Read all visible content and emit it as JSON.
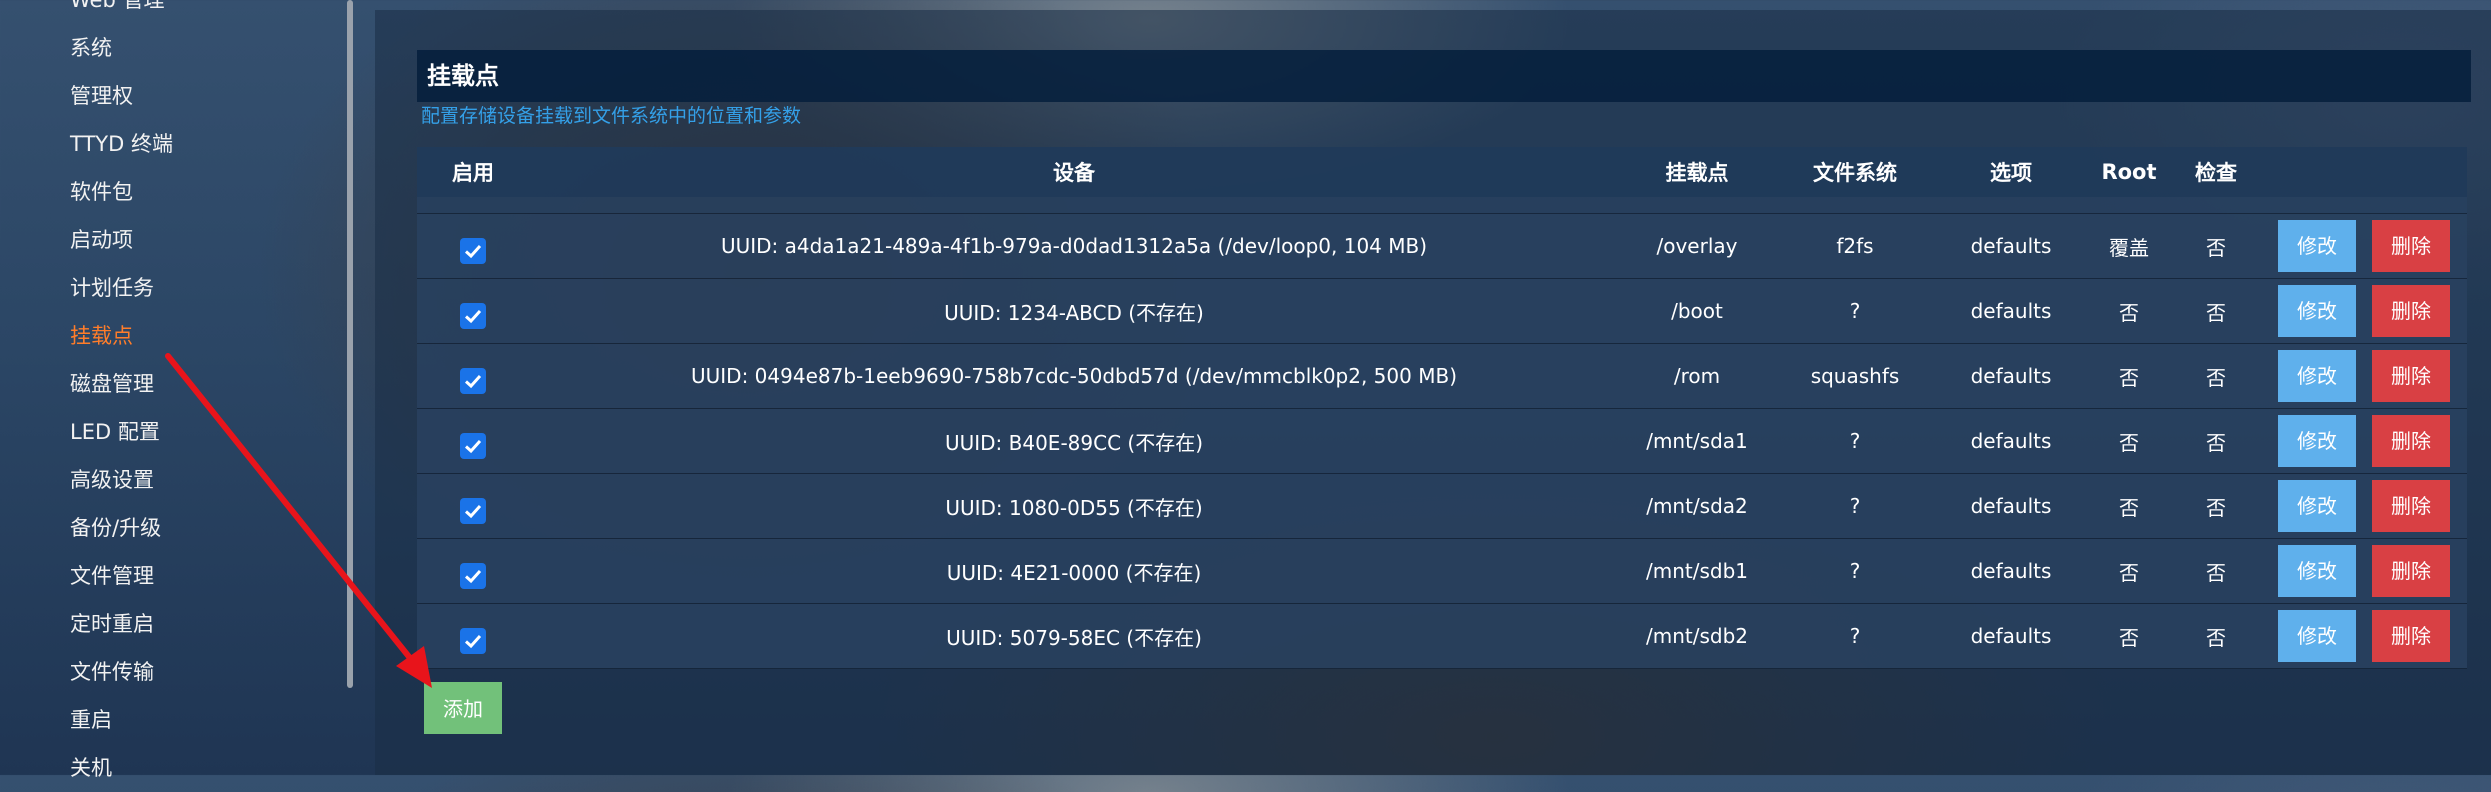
{
  "sidebar": {
    "items": [
      {
        "label": "Web 管理"
      },
      {
        "label": "系统"
      },
      {
        "label": "管理权"
      },
      {
        "label": "TTYD 终端"
      },
      {
        "label": "软件包"
      },
      {
        "label": "启动项"
      },
      {
        "label": "计划任务"
      },
      {
        "label": "挂载点"
      },
      {
        "label": "磁盘管理"
      },
      {
        "label": "LED 配置"
      },
      {
        "label": "高级设置"
      },
      {
        "label": "备份/升级"
      },
      {
        "label": "文件管理"
      },
      {
        "label": "定时重启"
      },
      {
        "label": "文件传输"
      },
      {
        "label": "重启"
      },
      {
        "label": "关机"
      }
    ],
    "active_label": "挂载点"
  },
  "section": {
    "title": "挂载点",
    "description": "配置存储设备挂载到文件系统中的位置和参数"
  },
  "table": {
    "headers": {
      "enabled": "启用",
      "device": "设备",
      "mountpoint": "挂载点",
      "filesystem": "文件系统",
      "options": "选项",
      "root": "Root",
      "check": "检查"
    },
    "rows": [
      {
        "enabled": true,
        "device": "UUID: a4da1a21-489a-4f1b-979a-d0dad1312a5a (/dev/loop0, 104 MB)",
        "mountpoint": "/overlay",
        "filesystem": "f2fs",
        "options": "defaults",
        "root": "覆盖",
        "check": "否",
        "edit": "修改",
        "delete": "删除"
      },
      {
        "enabled": true,
        "device": "UUID: 1234-ABCD (不存在)",
        "mountpoint": "/boot",
        "filesystem": "?",
        "options": "defaults",
        "root": "否",
        "check": "否",
        "edit": "修改",
        "delete": "删除"
      },
      {
        "enabled": true,
        "device": "UUID: 0494e87b-1eeb9690-758b7cdc-50dbd57d (/dev/mmcblk0p2, 500 MB)",
        "mountpoint": "/rom",
        "filesystem": "squashfs",
        "options": "defaults",
        "root": "否",
        "check": "否",
        "edit": "修改",
        "delete": "删除"
      },
      {
        "enabled": true,
        "device": "UUID: B40E-89CC (不存在)",
        "mountpoint": "/mnt/sda1",
        "filesystem": "?",
        "options": "defaults",
        "root": "否",
        "check": "否",
        "edit": "修改",
        "delete": "删除"
      },
      {
        "enabled": true,
        "device": "UUID: 1080-0D55 (不存在)",
        "mountpoint": "/mnt/sda2",
        "filesystem": "?",
        "options": "defaults",
        "root": "否",
        "check": "否",
        "edit": "修改",
        "delete": "删除"
      },
      {
        "enabled": true,
        "device": "UUID: 4E21-0000 (不存在)",
        "mountpoint": "/mnt/sdb1",
        "filesystem": "?",
        "options": "defaults",
        "root": "否",
        "check": "否",
        "edit": "修改",
        "delete": "删除"
      },
      {
        "enabled": true,
        "device": "UUID: 5079-58EC (不存在)",
        "mountpoint": "/mnt/sdb2",
        "filesystem": "?",
        "options": "defaults",
        "root": "否",
        "check": "否",
        "edit": "修改",
        "delete": "删除"
      }
    ]
  },
  "add_button": {
    "label": "添加"
  },
  "colors": {
    "sidebar_active": "#ff7d2a",
    "description_link": "#34a0e8",
    "checkbox": "#1a73e8",
    "edit_button": "#5fb0ec",
    "delete_button": "#d94044",
    "add_button": "#72c17a",
    "annotation_arrow": "#e8141b"
  },
  "icons": {
    "checkbox": "checkmark-icon"
  }
}
